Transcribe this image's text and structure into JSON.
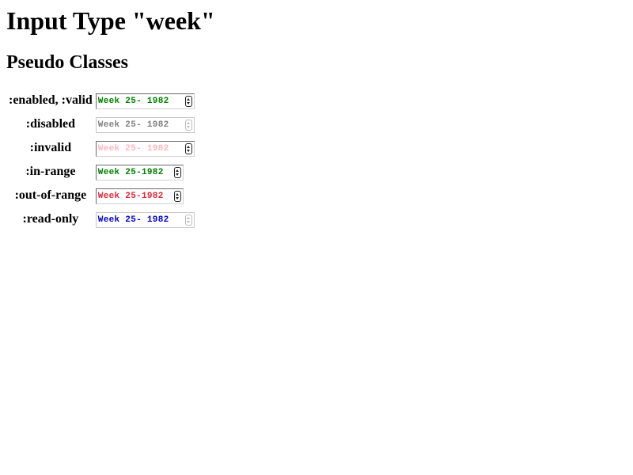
{
  "page": {
    "title": "Input Type \"week\"",
    "subtitle": "Pseudo Classes"
  },
  "rows": [
    {
      "label": ":enabled, :valid",
      "value": "Week 25- 1982",
      "color": "#008000"
    },
    {
      "label": ":disabled",
      "value": "Week 25- 1982",
      "color": "#808080"
    },
    {
      "label": ":invalid",
      "value": "Week 25- 1982",
      "color": "#ffb6c1"
    },
    {
      "label": ":in-range",
      "value": "Week 25-1982",
      "color": "#008000"
    },
    {
      "label": ":out-of-range",
      "value": "Week 25-1982",
      "color": "#e32636"
    },
    {
      "label": ":read-only",
      "value": "Week 25- 1982",
      "color": "#0000cd"
    }
  ]
}
